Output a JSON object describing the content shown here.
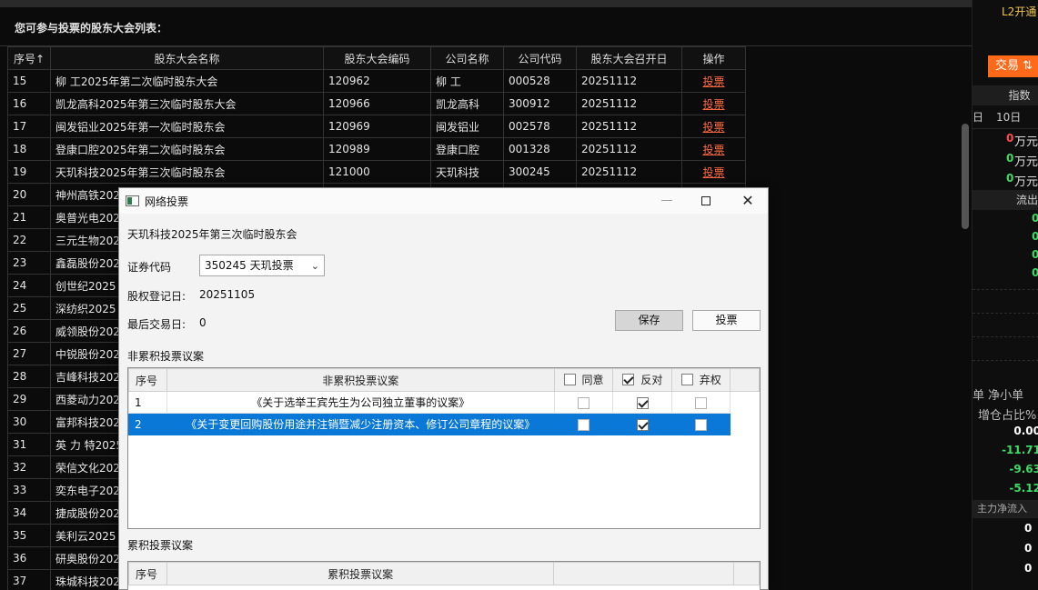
{
  "list": {
    "title": "您可参与投票的股东大会列表：",
    "columns": [
      "序号↑",
      "股东大会名称",
      "股东大会编码",
      "公司名称",
      "公司代码",
      "股东大会召开日",
      "操作"
    ],
    "rows": [
      {
        "idx": "15",
        "name": "柳 工2025年第二次临时股东大会",
        "code": "120962",
        "company": "柳 工",
        "stock": "000528",
        "date": "20251112",
        "op": "投票"
      },
      {
        "idx": "16",
        "name": "凯龙高科2025年第三次临时股东大会",
        "code": "120966",
        "company": "凯龙高科",
        "stock": "300912",
        "date": "20251112",
        "op": "投票"
      },
      {
        "idx": "17",
        "name": "闽发铝业2025年第一次临时股东会",
        "code": "120969",
        "company": "闽发铝业",
        "stock": "002578",
        "date": "20251112",
        "op": "投票"
      },
      {
        "idx": "18",
        "name": "登康口腔2025年第二次临时股东会",
        "code": "120989",
        "company": "登康口腔",
        "stock": "001328",
        "date": "20251112",
        "op": "投票"
      },
      {
        "idx": "19",
        "name": "天玑科技2025年第三次临时股东会",
        "code": "121000",
        "company": "天玑科技",
        "stock": "300245",
        "date": "20251112",
        "op": "投票"
      },
      {
        "idx": "20",
        "name": "神州高铁202"
      },
      {
        "idx": "21",
        "name": "奥普光电202"
      },
      {
        "idx": "22",
        "name": "三元生物202"
      },
      {
        "idx": "23",
        "name": "鑫磊股份202"
      },
      {
        "idx": "24",
        "name": "创世纪2025"
      },
      {
        "idx": "25",
        "name": "深纺织2025"
      },
      {
        "idx": "26",
        "name": "威领股份202"
      },
      {
        "idx": "27",
        "name": "中锐股份202"
      },
      {
        "idx": "28",
        "name": "吉峰科技202"
      },
      {
        "idx": "29",
        "name": "西菱动力202"
      },
      {
        "idx": "30",
        "name": "富邦科技202"
      },
      {
        "idx": "31",
        "name": "英 力 特2025"
      },
      {
        "idx": "32",
        "name": "荣信文化202"
      },
      {
        "idx": "33",
        "name": "奕东电子202"
      },
      {
        "idx": "34",
        "name": "捷成股份202"
      },
      {
        "idx": "35",
        "name": "美利云2025"
      },
      {
        "idx": "36",
        "name": "研奥股份202"
      },
      {
        "idx": "37",
        "name": "珠城科技202"
      }
    ]
  },
  "right_panel": {
    "l2": "L2开通",
    "trade": "交易 ⇅",
    "index_hdr": "指数",
    "day_a": "日",
    "day_b": "10日",
    "amounts": [
      {
        "num": "0",
        "unit": "万元"
      },
      {
        "num": "0",
        "unit": "万元"
      },
      {
        "num": "0",
        "unit": "万元"
      }
    ],
    "outflow_hdr": "流出",
    "outflow": [
      "0",
      "0",
      "0",
      "0"
    ],
    "order_hdr": "单  净小单",
    "ratio_hdr": "增仓占比%",
    "ratios": [
      "0.00",
      "-11.71",
      "-9.63",
      "-5.12"
    ],
    "main_hdr": "主力净流入",
    "main": [
      "0",
      "0",
      "0"
    ],
    "colors": {
      "red": "#ff4d4d",
      "green": "#3ddc65",
      "trade_bg": "#ff6a1a",
      "l2": "#f0c64a"
    }
  },
  "dialog": {
    "title": "网络投票",
    "meeting": "天玑科技2025年第三次临时股东会",
    "security_label": "证券代码",
    "security_value": "350245 天玑投票",
    "reg_label": "股权登记日:",
    "reg_value": "20251105",
    "last_label": "最后交易日:",
    "last_value": "0",
    "save": "保存",
    "vote": "投票",
    "noncum_label": "非累积投票议案",
    "noncum_cols": {
      "idx": "序号",
      "title": "非累积投票议案",
      "agree": "同意",
      "oppose": "反对",
      "abstain": "弃权"
    },
    "noncum_rows": [
      {
        "idx": "1",
        "title": "《关于选举王宾先生为公司独立董事的议案》",
        "agree": false,
        "oppose": true,
        "abstain": false
      },
      {
        "idx": "2",
        "title": "《关于变更回购股份用途并注销暨减少注册资本、修订公司章程的议案》",
        "agree": false,
        "oppose": true,
        "abstain": false
      }
    ],
    "cum_label": "累积投票议案",
    "cum_cols": {
      "idx": "序号",
      "title": "累积投票议案"
    },
    "selection_color": "#0a78d7"
  }
}
